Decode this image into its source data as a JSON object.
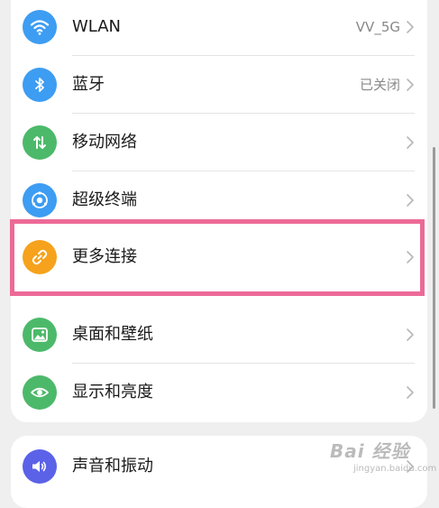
{
  "settings": {
    "group1": [
      {
        "label": "WLAN",
        "value": "VV_5G",
        "icon": "wifi-icon",
        "color": "#3d9df2"
      },
      {
        "label": "蓝牙",
        "value": "已关闭",
        "icon": "bluetooth-icon",
        "color": "#3d9df2"
      },
      {
        "label": "移动网络",
        "value": "",
        "icon": "mobile-data-icon",
        "color": "#4cb96a"
      },
      {
        "label": "超级终端",
        "value": "",
        "icon": "super-device-icon",
        "color": "#3d9df2"
      },
      {
        "label": "更多连接",
        "value": "",
        "icon": "link-icon",
        "color": "#f6a21c"
      },
      {
        "label": "桌面和壁纸",
        "value": "",
        "icon": "wallpaper-icon",
        "color": "#4cb96a"
      },
      {
        "label": "显示和亮度",
        "value": "",
        "icon": "eye-icon",
        "color": "#4cb96a"
      }
    ],
    "group2": [
      {
        "label": "声音和振动",
        "value": "",
        "icon": "volume-icon",
        "color": "#5b62e8"
      }
    ]
  },
  "highlight": {
    "color": "#ec6a97"
  },
  "watermark": {
    "logo": "Bai 经验",
    "sub": "jingyan.baidu.com"
  }
}
